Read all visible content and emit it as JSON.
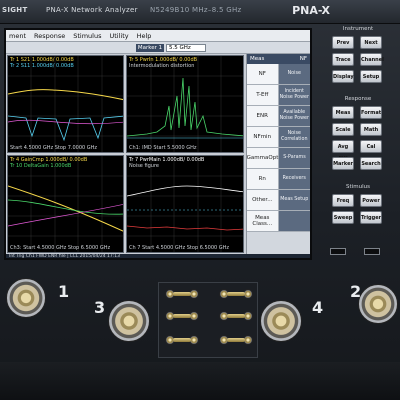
{
  "instrument": {
    "brand": "SIGHT",
    "title": "PNA-X Network Analyzer",
    "model_no": "N5249B",
    "freq_range": "10 MHz–8.5 GHz",
    "model_badge": "PNA-X"
  },
  "menu": [
    "ment",
    "Response",
    "Stimulus",
    "Utility",
    "Help"
  ],
  "toolbar": {
    "marker_label": "Marker 1",
    "marker_value": "5.5 GHz"
  },
  "plots": [
    {
      "header": [
        "Tr 1 S21 1.000dB/ 0.00dB",
        "Tr 2 S11 1.000dB/ 0.00dB"
      ],
      "footer": "Start 4.5000 GHz   Stop 7.0000 GHz",
      "color": "#f6d84a"
    },
    {
      "header": [
        "Tr 5 PwrIn 1.000dB/ 0.00dB",
        "Intermodulation distortion"
      ],
      "footer": "Ch1: IMD Start 5.5000 GHz",
      "color": "#4ad66a"
    },
    {
      "header": [
        "Tr 4 GainCmp 1.000dB/ 0.00dB",
        "Tr 10 DeltaGain 1.000dB"
      ],
      "footer": "Ch3: Start 4.5000 GHz   Stop 6.5000 GHz",
      "color": "#f6d84a"
    },
    {
      "header": [
        "Tr 7 PwrMain 1.000dB/ 0.00dB",
        "Noise figure"
      ],
      "footer": "Ch 7 Start 4.5000 GHz   Stop 6.5000 GHz",
      "color": "#ffffff"
    }
  ],
  "softkeys": {
    "title": "Meas",
    "title_right": "NF",
    "rows": [
      {
        "left": "NF",
        "right": "Noise"
      },
      {
        "left": "T-Eff",
        "right": "Incident Noise Power"
      },
      {
        "left": "ENR",
        "right": "Available Noise Power"
      },
      {
        "left": "NFmin",
        "right": "Noise Correlation"
      },
      {
        "left": "GammaOpt",
        "right": "S-Params"
      },
      {
        "left": "Rn",
        "right": "Receivers"
      },
      {
        "left": "Other...",
        "right": "Meas Setup"
      },
      {
        "left": "Meas Class...",
        "right": ""
      }
    ]
  },
  "status_bar": "Int Trig   Ch1 FWD  ENR file  |  LCL  2015/04/24 17:13",
  "hard_keys": {
    "instrument_label": "Instrument",
    "instrument": [
      "Prev",
      "Next",
      "Trace",
      "Channel",
      "Display",
      "Setup"
    ],
    "response_label": "Response",
    "response": [
      "Meas",
      "Format",
      "Scale",
      "Math",
      "Avg BW",
      "Cal",
      "Marker",
      "Search"
    ],
    "stimulus_label": "Stimulus",
    "stimulus": [
      "Freq",
      "Power",
      "Sweep",
      "Trigger"
    ]
  },
  "ports": {
    "p1": "1",
    "p2": "2",
    "p3": "3",
    "p4": "4"
  },
  "colors": {
    "plot_bg": "#000000",
    "trace_yellow": "#f6d84a",
    "trace_green": "#4ad66a",
    "trace_cyan": "#57d0f0",
    "panel_blue": "#3a4a63"
  }
}
